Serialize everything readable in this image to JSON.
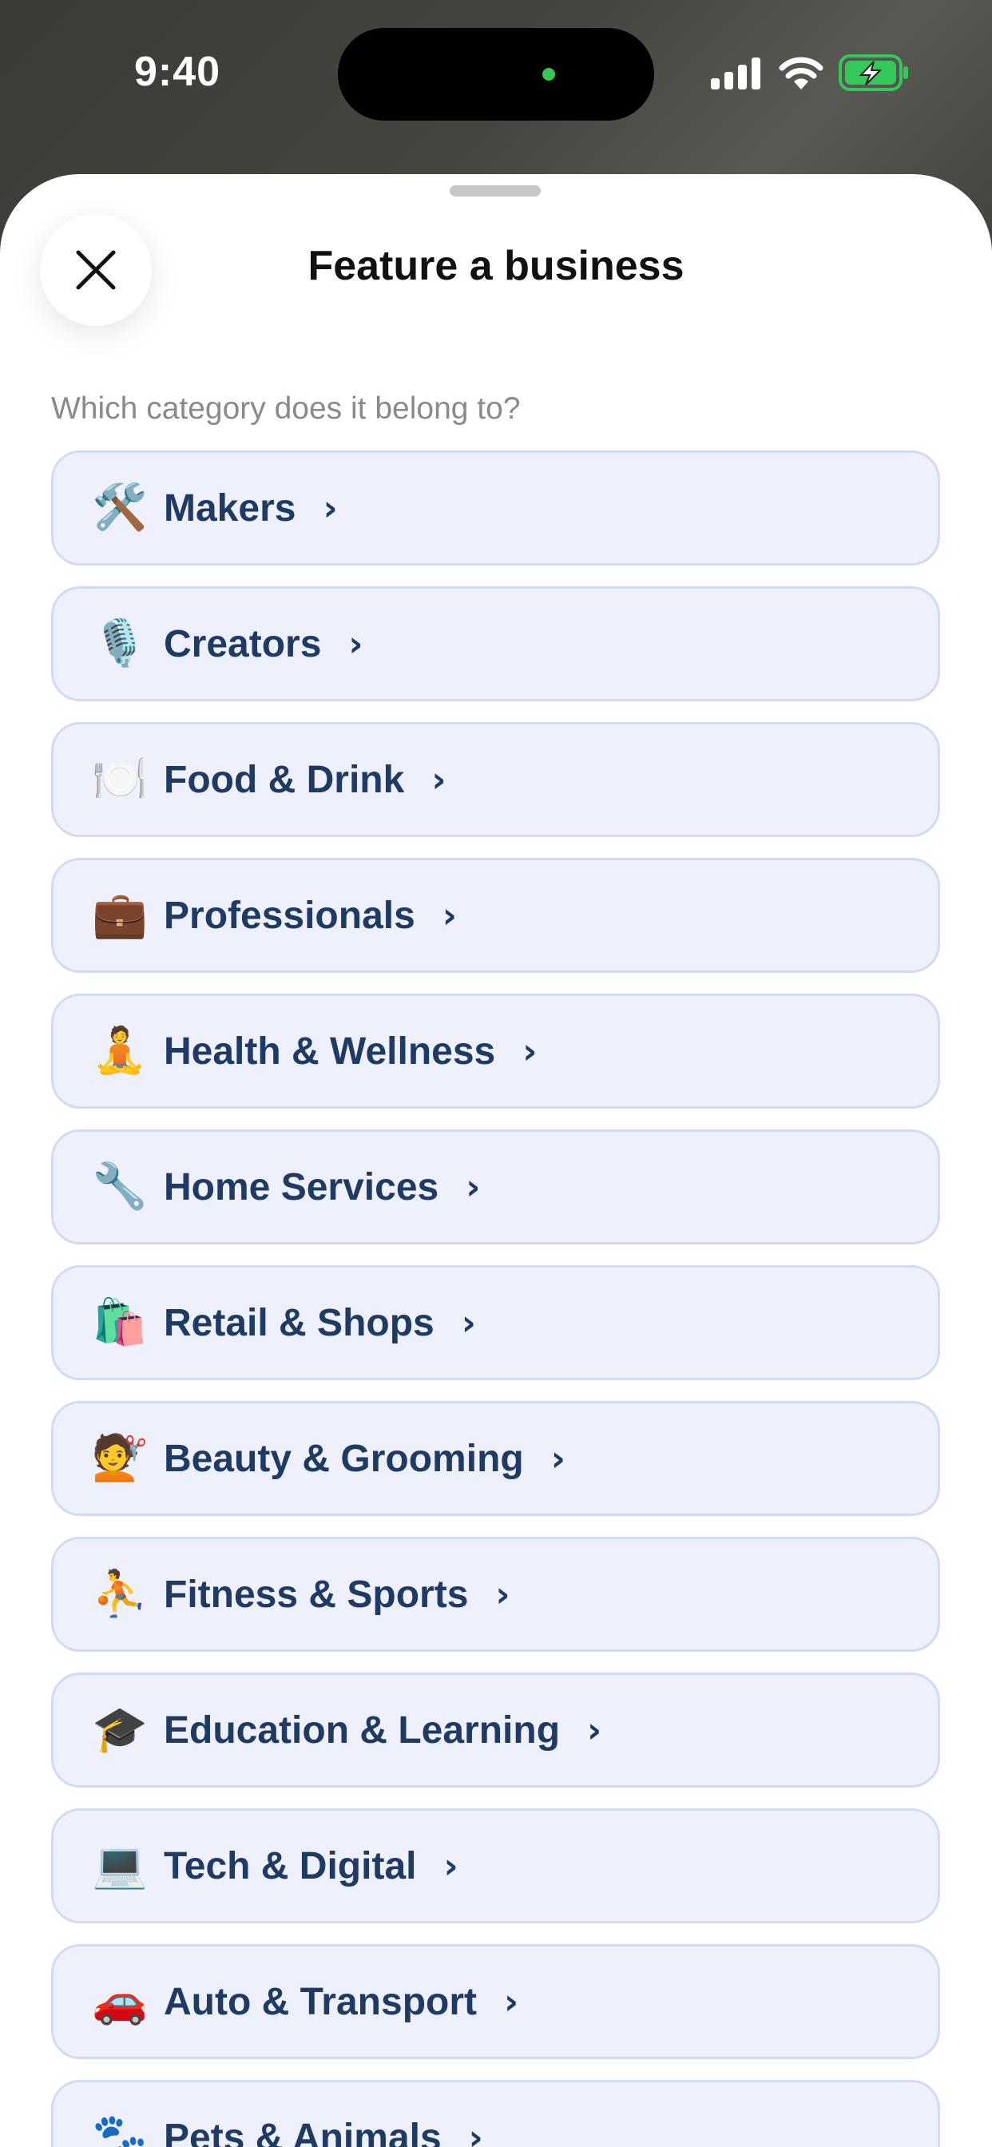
{
  "status_bar": {
    "time": "9:40",
    "island_dot_color": "#34c759",
    "battery_color": "#34c759",
    "icons": [
      "cellular-signal-icon",
      "wifi-icon",
      "battery-charging-icon"
    ]
  },
  "sheet": {
    "title": "Feature a business",
    "close_icon": "close-icon",
    "prompt": "Which category does it belong to?"
  },
  "categories": [
    {
      "emoji": "🛠️",
      "label": "Makers",
      "chevron": "›"
    },
    {
      "emoji": "🎙️",
      "label": "Creators",
      "chevron": "›"
    },
    {
      "emoji": "🍽️",
      "label": "Food & Drink",
      "chevron": "›"
    },
    {
      "emoji": "💼",
      "label": "Professionals",
      "chevron": "›"
    },
    {
      "emoji": "🧘",
      "label": "Health & Wellness",
      "chevron": "›"
    },
    {
      "emoji": "🔧",
      "label": "Home Services",
      "chevron": "›"
    },
    {
      "emoji": "🛍️",
      "label": "Retail & Shops",
      "chevron": "›"
    },
    {
      "emoji": "💇",
      "label": "Beauty & Grooming",
      "chevron": "›"
    },
    {
      "emoji": "⛹️",
      "label": "Fitness & Sports",
      "chevron": "›"
    },
    {
      "emoji": "🎓",
      "label": "Education & Learning",
      "chevron": "›"
    },
    {
      "emoji": "💻",
      "label": "Tech & Digital",
      "chevron": "›"
    },
    {
      "emoji": "🚗",
      "label": "Auto & Transport",
      "chevron": "›"
    },
    {
      "emoji": "🐾",
      "label": "Pets & Animals",
      "chevron": "›"
    }
  ],
  "colors": {
    "card_background": "#eef1fc",
    "card_border": "#d3dbf4",
    "label_text": "#1f3a63",
    "prompt_text": "#8a8a8e"
  }
}
